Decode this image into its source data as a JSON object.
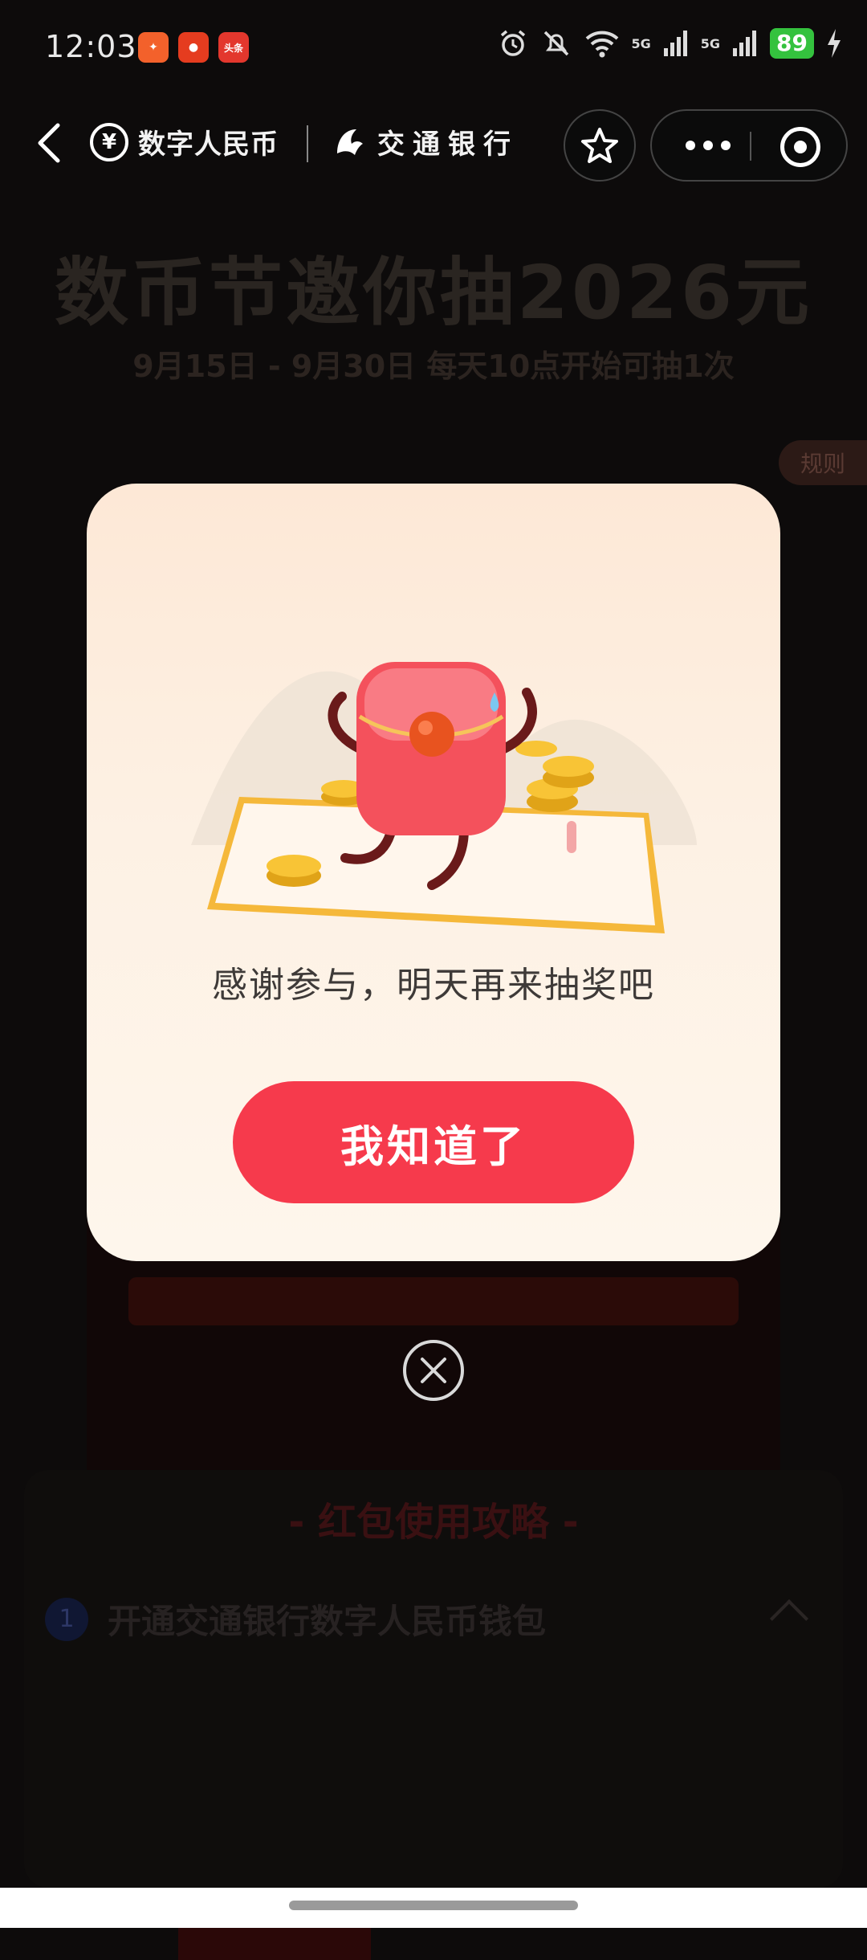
{
  "status_bar": {
    "time": "12:03",
    "network_1": "5G",
    "network_2": "5G",
    "battery": "89",
    "app_icons": [
      "app-icon-1",
      "app-icon-2",
      "头条"
    ]
  },
  "nav": {
    "brand_dcep": "数字人民币",
    "brand_bank": "交通银行"
  },
  "background": {
    "title": "数币节邀你抽2026元",
    "subtitle": "9月15日 - 9月30日 每天10点开始可抽1次",
    "rules_tag": "规则",
    "guide_title": "- 红包使用攻略 -",
    "step_number": "1",
    "step_text": "开通交通银行数字人民币钱包"
  },
  "modal": {
    "message": "感谢参与，明天再来抽奖吧",
    "confirm_label": "我知道了"
  },
  "colors": {
    "accent_red": "#f63a4c",
    "modal_bg": "#fdf1e4",
    "battery_green": "#34c23e"
  }
}
